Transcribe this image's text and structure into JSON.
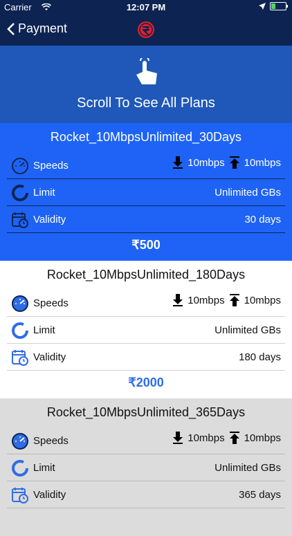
{
  "status_bar": {
    "carrier": "Carrier",
    "time": "12:07 PM"
  },
  "nav": {
    "back_label": "Payment"
  },
  "hero": {
    "title": "Scroll To See All Plans"
  },
  "plans": [
    {
      "name": "Rocket_10MbpsUnlimited_30Days",
      "speeds_label": "Speeds",
      "download": "10mbps",
      "upload": "10mbps",
      "limit_label": "Limit",
      "limit": "Unlimited GBs",
      "validity_label": "Validity",
      "validity": "30 days",
      "price": "₹500"
    },
    {
      "name": "Rocket_10MbpsUnlimited_180Days",
      "speeds_label": "Speeds",
      "download": "10mbps",
      "upload": "10mbps",
      "limit_label": "Limit",
      "limit": "Unlimited GBs",
      "validity_label": "Validity",
      "validity": "180 days",
      "price": "₹2000"
    },
    {
      "name": "Rocket_10MbpsUnlimited_365Days",
      "speeds_label": "Speeds",
      "download": "10mbps",
      "upload": "10mbps",
      "limit_label": "Limit",
      "limit": "Unlimited GBs",
      "validity_label": "Validity",
      "validity": "365 days",
      "price": ""
    }
  ],
  "colors": {
    "nav_bg": "#0d2352",
    "hero_bg": "#1f58b8",
    "selected_plan_bg": "#1e63f5",
    "price_blue": "#2f6ce6",
    "logo_red": "#e0202a",
    "battery_green": "#4cd964"
  },
  "icons": [
    "wifi-icon",
    "location-arrow-icon",
    "battery-icon",
    "back-chevron-icon",
    "rupee-logo-icon",
    "tap-hand-icon",
    "speedometer-icon",
    "download-arrow-icon",
    "upload-arrow-icon",
    "limit-circle-icon",
    "calendar-clock-icon"
  ]
}
